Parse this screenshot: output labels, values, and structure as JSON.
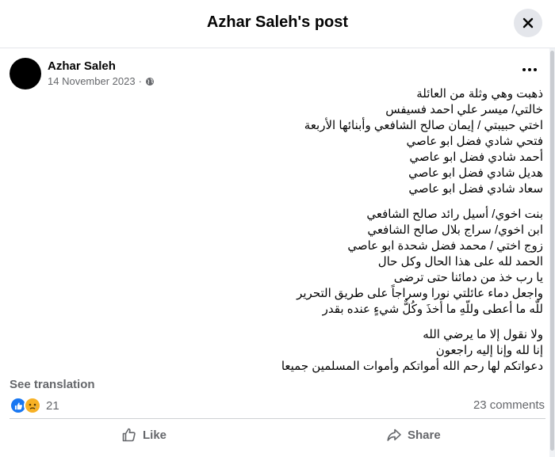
{
  "header": {
    "title": "Azhar Saleh's post"
  },
  "post": {
    "author": "Azhar Saleh",
    "date": "14 November 2023",
    "meta_separator": "·",
    "paragraphs": [
      [
        "ذهبت وهي وثلة من العائلة",
        "خالتي/ ميسر علي احمد فسيفس",
        "اختي حبيبتي / إيمان صالح الشافعي وأبنائها الأربعة",
        "فتحي شادي فضل ابو عاصي",
        "أحمد شادي فضل ابو عاصي",
        "هديل شادي فضل ابو عاصي",
        "سعاد شادي فضل ابو عاصي"
      ],
      [
        "بنت اخوي/ أسيل رائد صالح الشافعي",
        "ابن اخوي/ سراج بلال صالح الشافعي",
        "زوج اختي / محمد فضل شحدة ابو عاصي",
        "الحمد لله على هذا الحال وكل حال",
        "يا رب خذ من دمائنا حتى ترضى",
        "واجعل دماء عائلتي نورا وسراجاً على طريق التحرير",
        "للّه ما أعطى وللّهِ ما أخذَ وكُلٌّ شيءٍ عنده بقدر"
      ],
      [
        "ولا نقول إلا ما يرضي الله",
        "إنا لله وإنا إليه راجعون",
        "دعواتكم لها رحم الله أمواتكم وأموات المسلمين جميعا"
      ]
    ],
    "see_translation": "See translation",
    "reaction_count": "21",
    "comments": "23 comments"
  },
  "actions": {
    "like": "Like",
    "share": "Share"
  },
  "icons": {
    "close": "close-icon",
    "more": "more-options-icon",
    "privacy": "globe-icon",
    "like_reaction": "like-reaction-icon",
    "sad_reaction": "sad-reaction-icon",
    "like": "thumbs-up-icon",
    "share": "share-arrow-icon"
  },
  "colors": {
    "brand": "#1877f2",
    "sad": "#f7b125",
    "muted": "#65676b"
  }
}
